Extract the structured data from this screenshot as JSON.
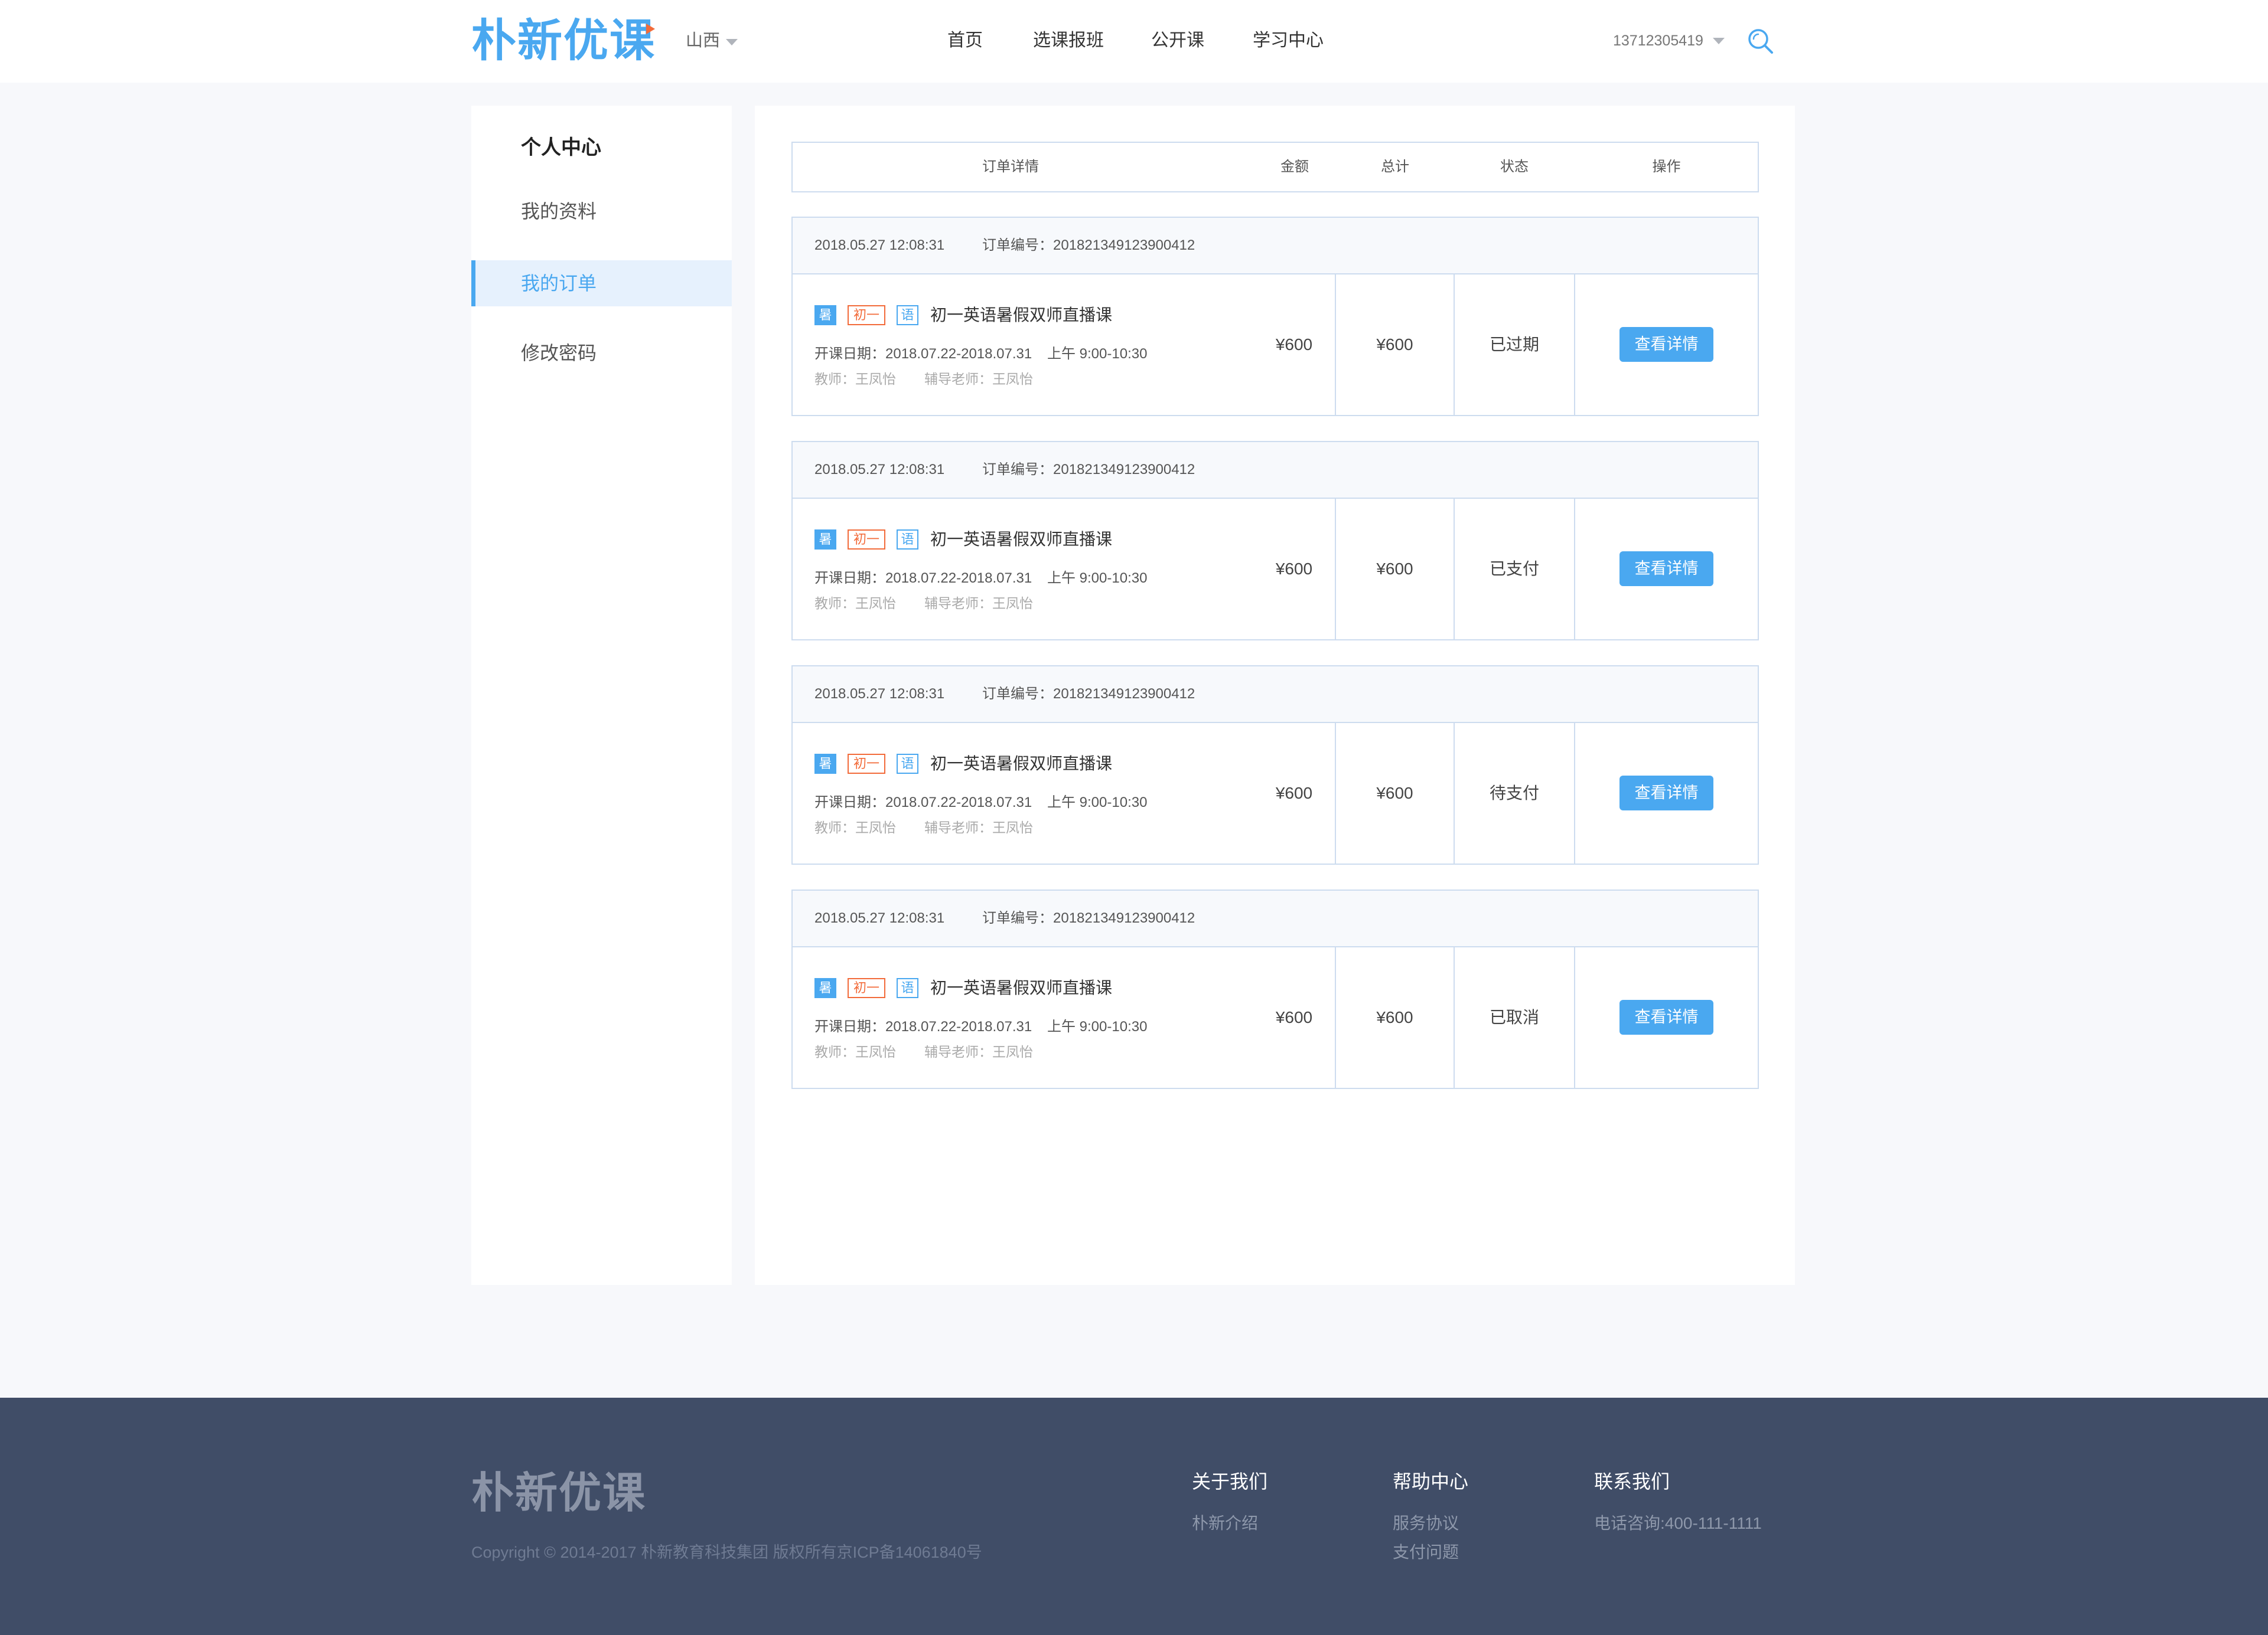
{
  "colors": {
    "accent": "#4aa8f0",
    "tag_orange": "#f26b3a",
    "page_bg": "#f7f8fb",
    "footer_bg": "#404d67"
  },
  "header": {
    "logo_text": "朴新优课",
    "region": "山西",
    "nav": [
      {
        "label": "首页"
      },
      {
        "label": "选课报班"
      },
      {
        "label": "公开课"
      },
      {
        "label": "学习中心"
      }
    ],
    "user_phone": "13712305419",
    "icons": {
      "region_caret": "caret-down-icon",
      "user_caret": "caret-down-icon",
      "search": "search-icon"
    }
  },
  "sidebar": {
    "title": "个人中心",
    "items": [
      {
        "label": "我的资料",
        "active": false
      },
      {
        "label": "我的订单",
        "active": true
      },
      {
        "label": "修改密码",
        "active": false
      }
    ]
  },
  "orders_table": {
    "columns": [
      "订单详情",
      "金额",
      "总计",
      "状态",
      "操作"
    ],
    "orders": [
      {
        "time": "2018.05.27 12:08:31",
        "order_no": "订单编号：201821349123900412",
        "tags": [
          "暑",
          "初一",
          "语"
        ],
        "title": "初一英语暑假双师直播课",
        "start_date": "开课日期：2018.07.22-2018.07.31",
        "session": "上午 9:00-10:30",
        "teacher": "教师：王凤怡",
        "tutor": "辅导老师：王凤怡",
        "amount": "¥600",
        "total": "¥600",
        "status": "已过期",
        "action_label": "查看详情"
      },
      {
        "time": "2018.05.27 12:08:31",
        "order_no": "订单编号：201821349123900412",
        "tags": [
          "暑",
          "初一",
          "语"
        ],
        "title": "初一英语暑假双师直播课",
        "start_date": "开课日期：2018.07.22-2018.07.31",
        "session": "上午 9:00-10:30",
        "teacher": "教师：王凤怡",
        "tutor": "辅导老师：王凤怡",
        "amount": "¥600",
        "total": "¥600",
        "status": "已支付",
        "action_label": "查看详情"
      },
      {
        "time": "2018.05.27 12:08:31",
        "order_no": "订单编号：201821349123900412",
        "tags": [
          "暑",
          "初一",
          "语"
        ],
        "title": "初一英语暑假双师直播课",
        "start_date": "开课日期：2018.07.22-2018.07.31",
        "session": "上午 9:00-10:30",
        "teacher": "教师：王凤怡",
        "tutor": "辅导老师：王凤怡",
        "amount": "¥600",
        "total": "¥600",
        "status": "待支付",
        "action_label": "查看详情"
      },
      {
        "time": "2018.05.27 12:08:31",
        "order_no": "订单编号：201821349123900412",
        "tags": [
          "暑",
          "初一",
          "语"
        ],
        "title": "初一英语暑假双师直播课",
        "start_date": "开课日期：2018.07.22-2018.07.31",
        "session": "上午 9:00-10:30",
        "teacher": "教师：王凤怡",
        "tutor": "辅导老师：王凤怡",
        "amount": "¥600",
        "total": "¥600",
        "status": "已取消",
        "action_label": "查看详情"
      }
    ]
  },
  "footer": {
    "logo_text": "朴新优课",
    "copyright": "Copyright © 2014-2017 朴新教育科技集团 版权所有京ICP备14061840号",
    "columns": [
      {
        "title": "关于我们",
        "links": [
          "朴新介绍"
        ]
      },
      {
        "title": "帮助中心",
        "links": [
          "服务协议",
          "支付问题"
        ]
      },
      {
        "title": "联系我们",
        "links": [
          "电话咨询:400-111-1111"
        ]
      }
    ]
  }
}
